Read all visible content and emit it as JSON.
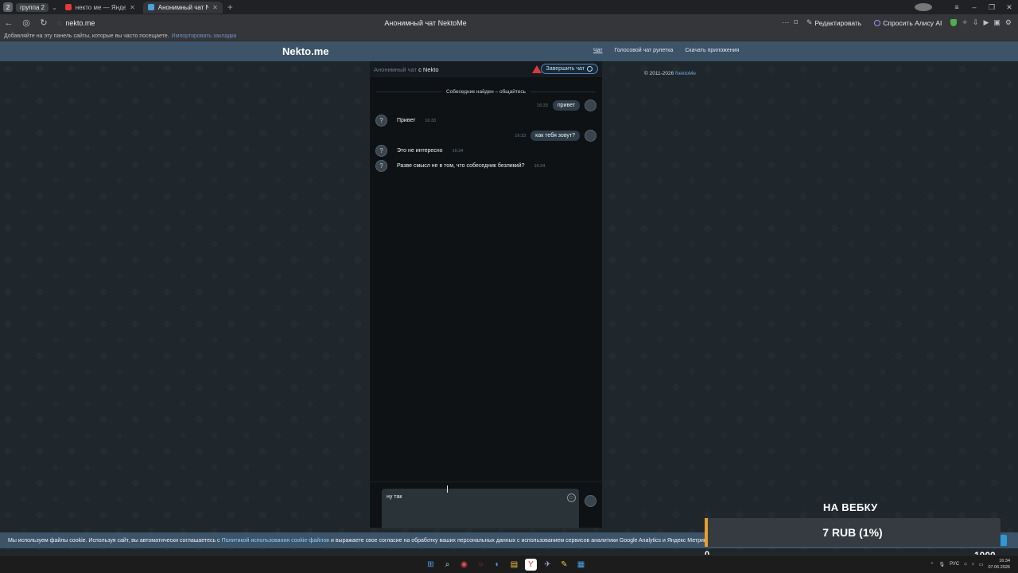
{
  "browser": {
    "group_count": "2",
    "group_label": "группа 2",
    "tabs": [
      {
        "title": "некто ме — Яндекс: нашлось",
        "favicon_color": "#e53935"
      },
      {
        "title": "Анонимный чат NektoMe",
        "favicon_color": "#4aa3df"
      }
    ],
    "url": "nekto.me",
    "page_title": "Анонимный чат NektoMe",
    "edit_label": "Редактировать",
    "ask_alice_label": "Спросить Алису AI",
    "bookmarks_hint": "Добавляйте на эту панель сайты, которые вы часто посещаете.",
    "bookmarks_import": "Импортировать закладки"
  },
  "site": {
    "logo": "Nekto.me",
    "nav": [
      {
        "label": "Чат"
      },
      {
        "label": "Голосовой чат рулетка"
      },
      {
        "label": "Скачать приложения"
      }
    ],
    "copyright_prefix": "© 2011-2026",
    "copyright_link": "NektoMe"
  },
  "chat": {
    "title_muted": "Анонимный чат",
    "title_main": "с Nekto",
    "end_button": "Завершить чат",
    "system_message": "Собеседник найден – общайтесь",
    "messages": [
      {
        "from": "me",
        "text": "привет",
        "time": "16:33"
      },
      {
        "from": "them",
        "text": "Привет",
        "time": "16:33"
      },
      {
        "from": "me",
        "text": "как тебя зовут?",
        "time": "16:33"
      },
      {
        "from": "them",
        "text": "Это не интересно",
        "time": "16:34"
      },
      {
        "from": "them",
        "text": "Разве смысл не в том, что собеседник безликий?",
        "time": "16:34"
      }
    ],
    "input_value": "ну так"
  },
  "cookie": {
    "text_before": "Мы используем файлы cookie. Используя сайт, вы автоматически соглашаетесь с",
    "link": "Политикой использования cookie-файлов",
    "text_after": "и выражаете свое согласие на обработку ваших персональных данных с использованием сервисов аналитики Google Analytics и Яндекс Метрика"
  },
  "donation": {
    "title": "НА ВЕБКУ",
    "value_label": "7 RUB (1%)",
    "progress": 0.01,
    "min": "0",
    "max": "1000",
    "fill_color": "#e89d2d"
  },
  "taskbar": {
    "lang": "РУС",
    "time": "16:34",
    "date": "07.06.2026"
  }
}
